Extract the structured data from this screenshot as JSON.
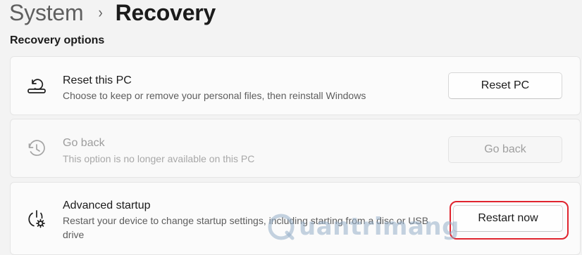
{
  "breadcrumb": {
    "parent": "System",
    "separator": "›",
    "current": "Recovery"
  },
  "section": {
    "title": "Recovery options"
  },
  "cards": [
    {
      "icon": "reset-pc-icon",
      "title": "Reset this PC",
      "description": "Choose to keep or remove your personal files, then reinstall Windows",
      "button": "Reset PC",
      "enabled": true
    },
    {
      "icon": "history-icon",
      "title": "Go back",
      "description": "This option is no longer available on this PC",
      "button": "Go back",
      "enabled": false
    },
    {
      "icon": "advanced-startup-icon",
      "title": "Advanced startup",
      "description": "Restart your device to change startup settings, including starting from a disc or USB drive",
      "button": "Restart now",
      "enabled": true,
      "highlighted": true
    }
  ],
  "watermark": {
    "text": "uantrimang"
  },
  "colors": {
    "background": "#f3f3f3",
    "card": "#fbfbfb",
    "highlight": "#e0242e"
  }
}
